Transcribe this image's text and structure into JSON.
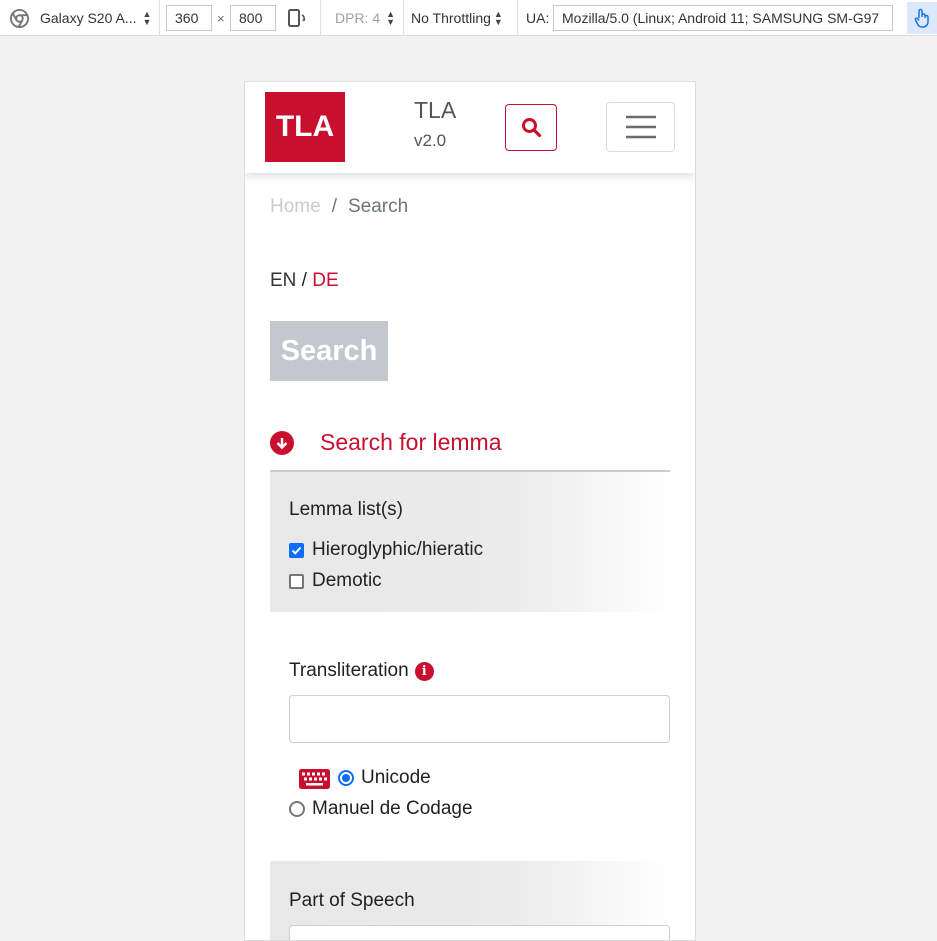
{
  "devtools": {
    "device": "Galaxy S20 A...",
    "width": "360",
    "times": "×",
    "height": "800",
    "dpr": "DPR: 4",
    "throttle": "No Throttling",
    "ua_label": "UA:",
    "ua_value": "Mozilla/5.0 (Linux; Android 11; SAMSUNG SM-G97"
  },
  "header": {
    "logo": "TLA",
    "title": "TLA",
    "version": "v2.0"
  },
  "breadcrumb": {
    "home": "Home",
    "separator": "/",
    "current": "Search"
  },
  "lang": {
    "en": "EN",
    "sep": " / ",
    "de": "DE"
  },
  "page": {
    "heading": "Search"
  },
  "section": {
    "title": "Search for lemma"
  },
  "lemma_lists": {
    "title": "Lemma list(s)",
    "options": [
      {
        "label": "Hieroglyphic/hieratic",
        "checked": true
      },
      {
        "label": "Demotic",
        "checked": false
      }
    ]
  },
  "transliteration": {
    "label": "Transliteration",
    "info": "i",
    "value": "",
    "modes": [
      {
        "label": "Unicode",
        "selected": true
      },
      {
        "label": "Manuel de Codage",
        "selected": false
      }
    ]
  },
  "part_of_speech": {
    "label": "Part of Speech"
  },
  "colors": {
    "brand": "#c8102e",
    "accent": "#0d6efd"
  }
}
